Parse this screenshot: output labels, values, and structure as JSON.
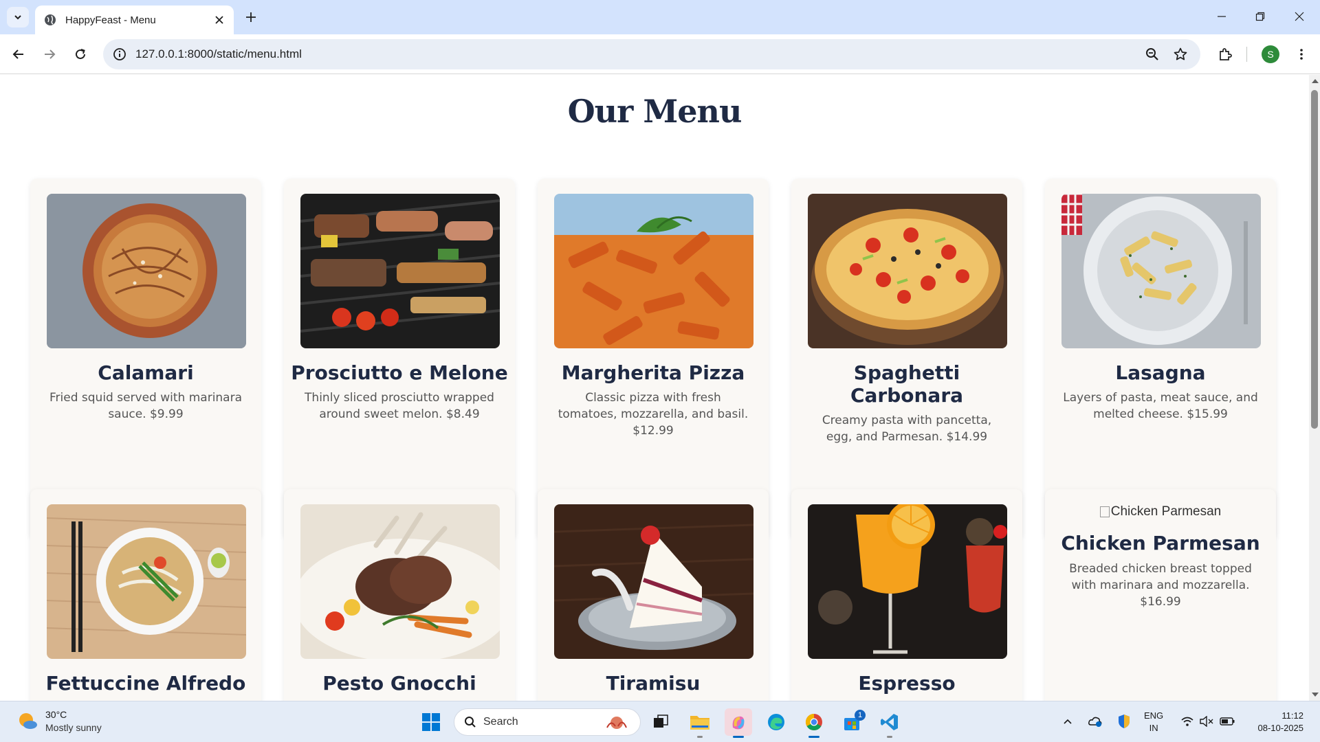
{
  "browser": {
    "tab_title": "HappyFeast - Menu",
    "url": "127.0.0.1:8000/static/menu.html",
    "profile_initial": "S",
    "icons": [
      "tab-search-icon",
      "globe-icon",
      "close-icon",
      "plus-icon",
      "minimize-icon",
      "restore-icon",
      "back-icon",
      "forward-icon",
      "reload-icon",
      "info-icon",
      "zoom-icon",
      "star-icon",
      "extensions-icon",
      "menu-icon"
    ]
  },
  "page": {
    "title": "Our Menu",
    "items": [
      {
        "name": "Calamari",
        "description": "Fried squid served with marinara sauce. $9.99",
        "image": "spaghetti-bowl"
      },
      {
        "name": "Prosciutto e Melone",
        "description": "Thinly sliced prosciutto wrapped around sweet melon. $8.49",
        "image": "grill-skewers"
      },
      {
        "name": "Margherita Pizza",
        "description": "Classic pizza with fresh tomatoes, mozzarella, and basil. $12.99",
        "image": "penne-pasta"
      },
      {
        "name": "Spaghetti Carbonara",
        "description": "Creamy pasta with pancetta, egg, and Parmesan. $14.99",
        "image": "pizza"
      },
      {
        "name": "Lasagna",
        "description": "Layers of pasta, meat sauce, and melted cheese. $15.99",
        "image": "penne-plate"
      },
      {
        "name": "Fettuccine Alfredo",
        "description": "",
        "image": "noodle-soup"
      },
      {
        "name": "Pesto Gnocchi",
        "description": "",
        "image": "lamb-chops"
      },
      {
        "name": "Tiramisu",
        "description": "",
        "image": "cake-slice"
      },
      {
        "name": "Espresso",
        "description": "",
        "image": "cocktail"
      },
      {
        "name": "Chicken Parmesan",
        "description": "Breaded chicken breast topped with marinara and mozzarella. $16.99",
        "image_alt": "Chicken Parmesan"
      }
    ]
  },
  "taskbar": {
    "weather_temp": "30°C",
    "weather_desc": "Mostly sunny",
    "search_placeholder": "Search",
    "store_badge": "1",
    "lang_line1": "ENG",
    "lang_line2": "IN",
    "time": "11:12",
    "date": "08-10-2025"
  },
  "colors": {
    "accent": "#1f2a44",
    "tabbar": "#d3e3fd",
    "card_bg": "#faf8f5",
    "taskbar": "#e4ecf7"
  }
}
